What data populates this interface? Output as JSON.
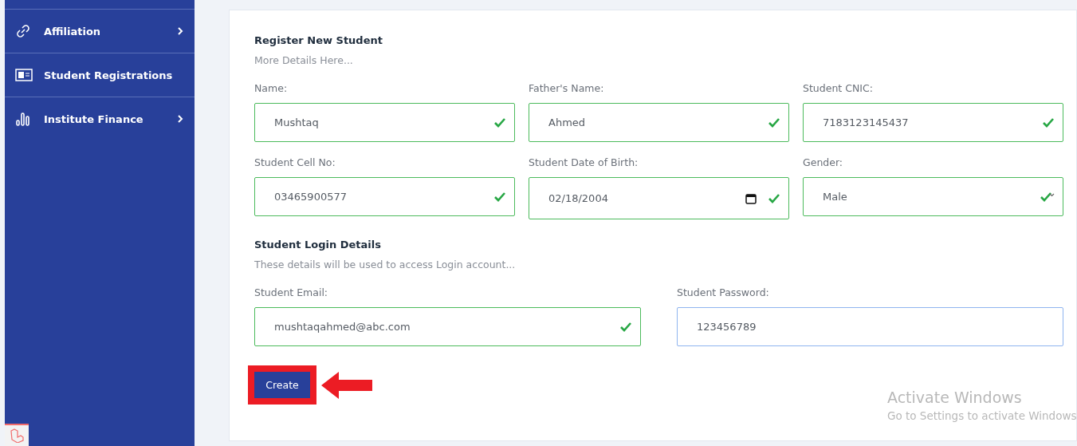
{
  "sidebar": {
    "items": [
      {
        "label": "Affiliation",
        "has_submenu": true
      },
      {
        "label": "Student Registrations",
        "has_submenu": false
      },
      {
        "label": "Institute Finance",
        "has_submenu": true
      }
    ]
  },
  "form": {
    "title": "Register New Student",
    "subtitle": "More Details Here...",
    "fields": [
      {
        "label": "Name:",
        "value": "Mushtaq",
        "kind": "text",
        "valid": true,
        "focused": false
      },
      {
        "label": "Father's Name:",
        "value": "Ahmed",
        "kind": "text",
        "valid": true,
        "focused": false
      },
      {
        "label": "Student CNIC:",
        "value": "7183123145437",
        "kind": "text",
        "valid": true,
        "focused": false
      },
      {
        "label": "Student Cell No:",
        "value": "03465900577",
        "kind": "text",
        "valid": true,
        "focused": false
      },
      {
        "label": "Student Date of Birth:",
        "value": "02/18/2004",
        "kind": "date",
        "valid": true,
        "focused": false
      },
      {
        "label": "Gender:",
        "value": "Male",
        "kind": "select",
        "valid": true,
        "focused": false
      }
    ],
    "login_title": "Student Login Details",
    "login_subtitle": "These details will be used to access Login account...",
    "login_fields": [
      {
        "label": "Student Email:",
        "value": "mushtaqahmed@abc.com",
        "kind": "text",
        "valid": true,
        "focused": false
      },
      {
        "label": "Student Password:",
        "value": "123456789",
        "kind": "text",
        "valid": false,
        "focused": true
      }
    ],
    "button": "Create",
    "highlighted": true
  },
  "activation": {
    "title": "Activate Windows",
    "message": "Go to Settings to activate Windows"
  }
}
